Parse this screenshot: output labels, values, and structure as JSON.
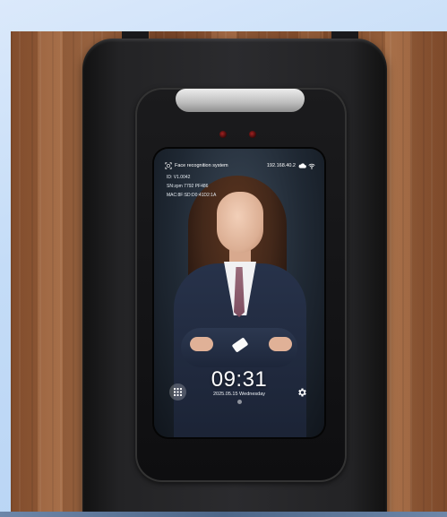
{
  "device_screen": {
    "status_bar": {
      "title": "Face recognition system",
      "ip": "192.168.40.2",
      "icons": [
        "face-scan-icon",
        "cloud-icon",
        "wifi-icon"
      ]
    },
    "info_lines": [
      "ID: V1.0042",
      "SN:zpm 7792 PF486",
      "MAC:8F:SD:D0:41D2:1A"
    ],
    "clock": {
      "time": "09:31",
      "date": "2025.05.15 Wednesday"
    },
    "buttons": {
      "apps_icon": "grid-icon",
      "settings_icon": "gear-icon"
    }
  },
  "colors": {
    "background": "#c4dcf7",
    "wall_wood": "#9c633f",
    "device_body": "#2b2b2e",
    "screen_bg": "#1f2833",
    "clock_text": "#ffffff"
  }
}
